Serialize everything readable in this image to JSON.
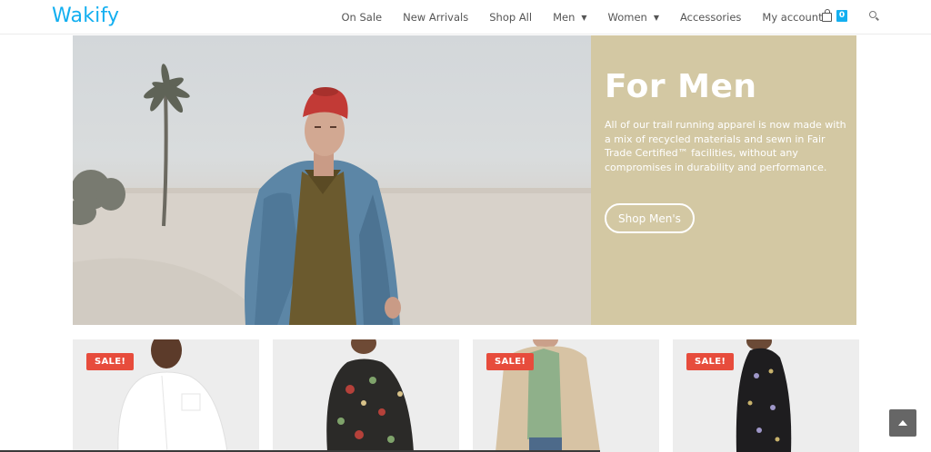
{
  "brand": {
    "logo": "Wakify",
    "accent_color": "#13aff0"
  },
  "nav": {
    "items": [
      {
        "label": "On Sale",
        "dropdown": false
      },
      {
        "label": "New Arrivals",
        "dropdown": false
      },
      {
        "label": "Shop All",
        "dropdown": false
      },
      {
        "label": "Men",
        "dropdown": true
      },
      {
        "label": "Women",
        "dropdown": true
      },
      {
        "label": "Accessories",
        "dropdown": false
      },
      {
        "label": "My account",
        "dropdown": false
      }
    ],
    "cart_count": "0",
    "cart_icon": "shopping-bag-icon",
    "search_icon": "search-icon"
  },
  "hero": {
    "title": "For Men",
    "description": "All of our trail running apparel is now made with a mix of recycled materials and sewn in Fair Trade Certified™ facilities, without any compromises in durability and performance.",
    "button_label": "Shop Men's",
    "panel_color": "#d3c8a3"
  },
  "products": [
    {
      "badge": "SALE!",
      "item": "white shirt"
    },
    {
      "badge": "",
      "item": "dark floral shirt"
    },
    {
      "badge": "SALE!",
      "item": "beige jacket"
    },
    {
      "badge": "SALE!",
      "item": "black print shirt"
    }
  ],
  "badge_color": "#e74c3c",
  "back_to_top_icon": "arrow-up-icon"
}
